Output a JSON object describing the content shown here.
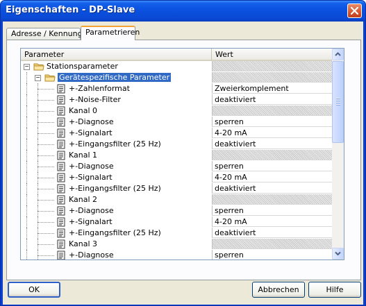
{
  "window": {
    "title": "Eigenschaften - DP-Slave"
  },
  "tabs": [
    {
      "label": "Adresse / Kennung",
      "active": false
    },
    {
      "label": "Parametrieren",
      "active": true
    }
  ],
  "columns": {
    "parameter": "Parameter",
    "value": "Wert"
  },
  "rows": [
    {
      "label": "Stationsparameter",
      "type": "folder",
      "level": 0,
      "expanded": true,
      "value": null
    },
    {
      "label": "Gerätespezifische Parameter",
      "type": "folder",
      "level": 1,
      "expanded": true,
      "selected": true,
      "value": null
    },
    {
      "label": "+-Zahlenformat",
      "type": "param",
      "level": 2,
      "value": "Zweierkomplement"
    },
    {
      "label": "+-Noise-Filter",
      "type": "param",
      "level": 2,
      "value": "deaktiviert"
    },
    {
      "label": "Kanal 0",
      "type": "param",
      "level": 2,
      "value": null
    },
    {
      "label": "+-Diagnose",
      "type": "param",
      "level": 2,
      "value": "sperren"
    },
    {
      "label": "+-Signalart",
      "type": "param",
      "level": 2,
      "value": "4-20 mA"
    },
    {
      "label": "+-Eingangsfilter (25 Hz)",
      "type": "param",
      "level": 2,
      "value": "deaktiviert"
    },
    {
      "label": "Kanal 1",
      "type": "param",
      "level": 2,
      "value": null
    },
    {
      "label": "+-Diagnose",
      "type": "param",
      "level": 2,
      "value": "sperren"
    },
    {
      "label": "+-Signalart",
      "type": "param",
      "level": 2,
      "value": "4-20 mA"
    },
    {
      "label": "+-Eingangsfilter (25 Hz)",
      "type": "param",
      "level": 2,
      "value": "deaktiviert"
    },
    {
      "label": "Kanal 2",
      "type": "param",
      "level": 2,
      "value": null
    },
    {
      "label": "+-Diagnose",
      "type": "param",
      "level": 2,
      "value": "sperren"
    },
    {
      "label": "+-Signalart",
      "type": "param",
      "level": 2,
      "value": "4-20 mA"
    },
    {
      "label": "+-Eingangsfilter (25 Hz)",
      "type": "param",
      "level": 2,
      "value": "deaktiviert"
    },
    {
      "label": "Kanal 3",
      "type": "param",
      "level": 2,
      "value": null
    },
    {
      "label": "+-Diagnose",
      "type": "param",
      "level": 2,
      "value": "sperren"
    }
  ],
  "buttons": {
    "ok": "OK",
    "cancel": "Abbrechen",
    "help": "Hilfe"
  },
  "colors": {
    "titlebar": "#0a4fe0",
    "selection": "#316ac5",
    "tab_highlight": "#f1a233"
  },
  "icons": {
    "close": "close-icon",
    "folder": "folder-icon",
    "param": "parameter-doc-icon",
    "collapse": "collapse-minus-icon",
    "scroll_up": "arrow-up-icon",
    "scroll_down": "arrow-down-icon"
  }
}
